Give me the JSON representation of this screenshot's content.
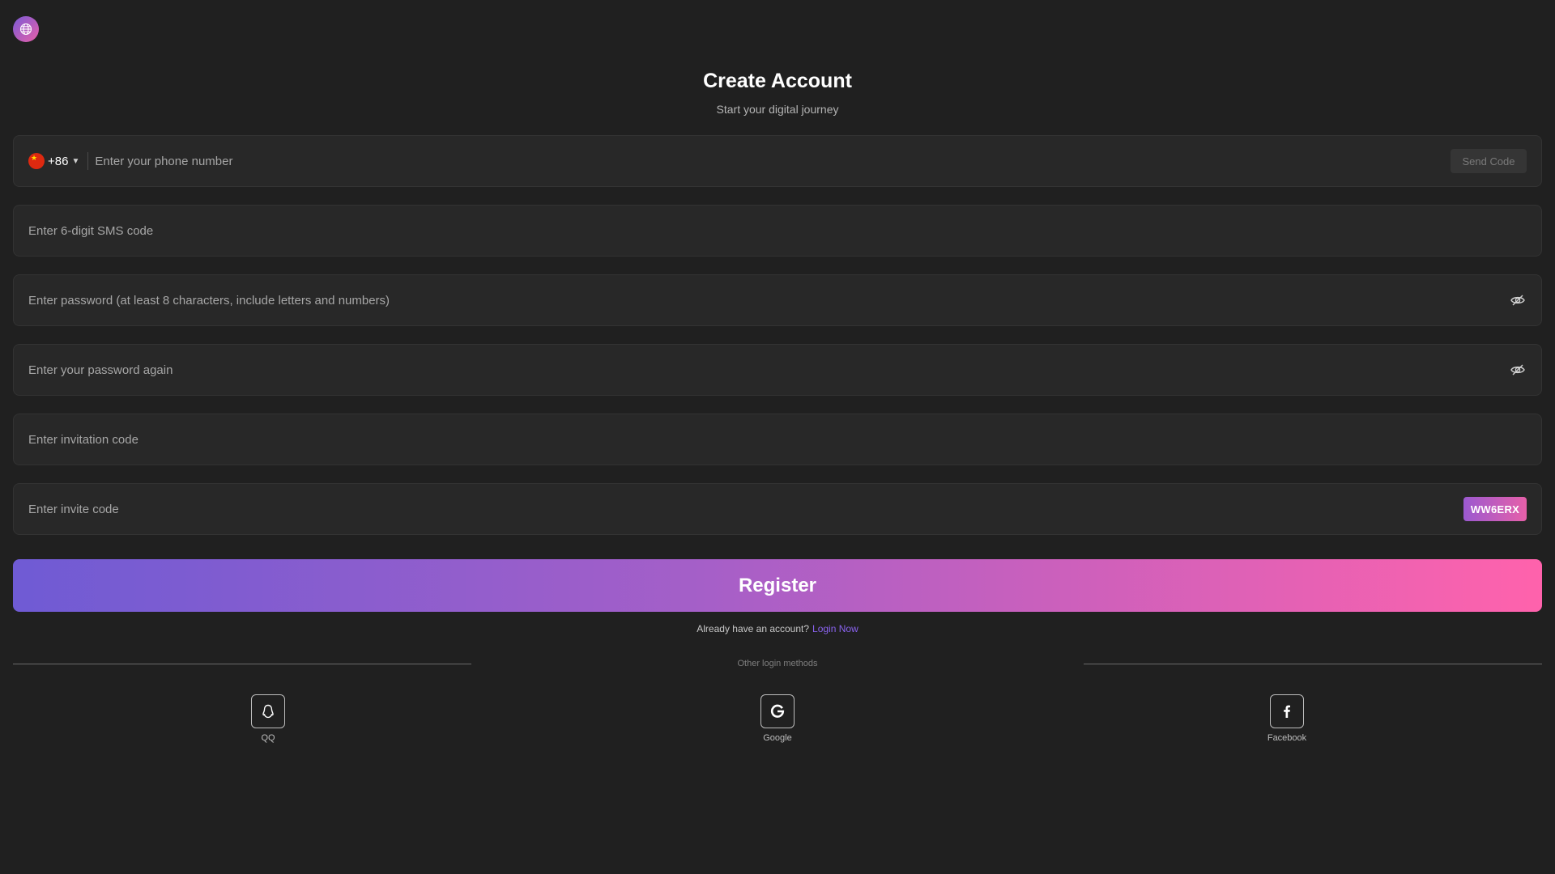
{
  "header": {
    "title": "Create Account",
    "subtitle": "Start your digital journey"
  },
  "phone": {
    "country_code": "+86",
    "flag": "china-flag",
    "placeholder": "Enter your phone number",
    "send_code_label": "Send Code"
  },
  "sms": {
    "placeholder": "Enter 6-digit SMS code"
  },
  "password": {
    "placeholder": "Enter password (at least 8 characters, include letters and numbers)"
  },
  "confirm_password": {
    "placeholder": "Enter your password again"
  },
  "invitation": {
    "placeholder": "Enter invitation code"
  },
  "invite": {
    "placeholder": "Enter invite code",
    "captcha_text": "WW6ERX"
  },
  "register_label": "Register",
  "login_prompt": {
    "text": "Already have an account?",
    "link": "Login Now"
  },
  "other_methods_label": "Other login methods",
  "social": [
    {
      "label": "QQ",
      "icon": "qq-icon"
    },
    {
      "label": "Google",
      "icon": "google-icon"
    },
    {
      "label": "Facebook",
      "icon": "facebook-icon"
    }
  ],
  "colors": {
    "background": "#202020",
    "field_bg": "#282828",
    "accent_start": "#6f5bd4",
    "accent_end": "#ff62ac",
    "link": "#8a63f0"
  }
}
